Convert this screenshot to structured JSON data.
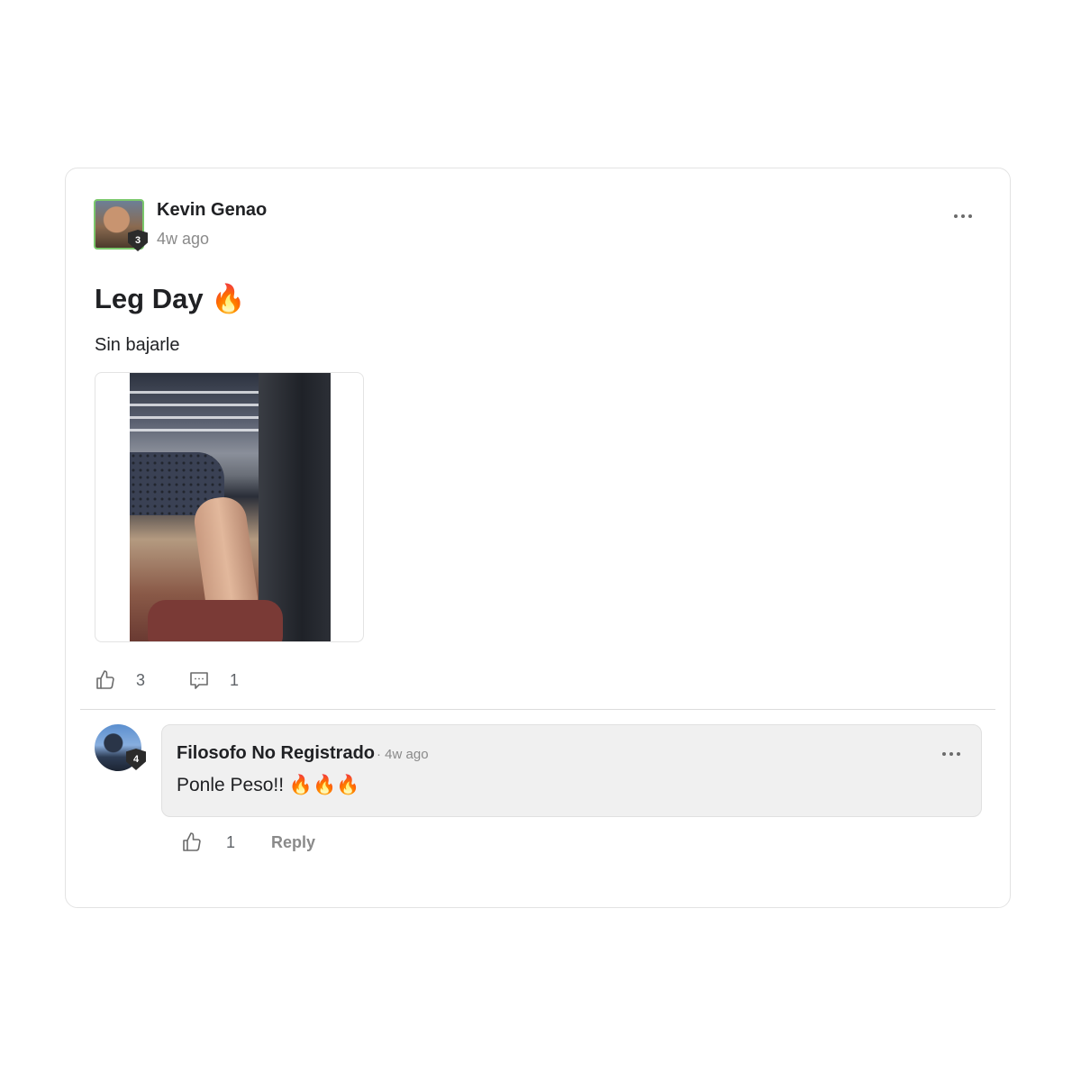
{
  "post": {
    "author": "Kevin Genao",
    "author_level": "3",
    "timestamp": "4w ago",
    "title": "Leg Day 🔥",
    "body": "Sin bajarle",
    "likes": "3",
    "comments": "1",
    "menu_icon": "more-horizontal-icon"
  },
  "comment": {
    "author": "Filosofo No Registrado",
    "author_level": "4",
    "meta": "· 4w ago",
    "text": "Ponle Peso!! 🔥🔥🔥",
    "likes": "1",
    "reply_label": "Reply"
  },
  "colors": {
    "avatar_border": "#7bc86c",
    "comment_bg": "#f0f0f0",
    "muted_text": "#8a8a8a"
  }
}
